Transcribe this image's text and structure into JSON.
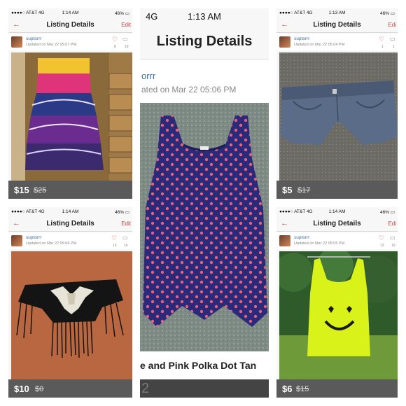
{
  "panels": {
    "p1": {
      "carrier": "●●●●○ AT&T  4G",
      "time": "1:14 AM",
      "battery": "46%",
      "back": "←",
      "title": "Listing Details",
      "edit": "Edit",
      "seller": "suptorrr",
      "updated": "Updated on Mar 22 05:07 PM",
      "likes": "8",
      "comments": "19",
      "price": "$15",
      "original_price": "$25"
    },
    "p2": {
      "carrier": "4G",
      "time": "1:13 AM",
      "title": "Listing Details",
      "seller": "orrr",
      "updated": "ated on Mar 22 05:06 PM",
      "caption": "e and Pink Polka Dot Tan",
      "price_partial": "2"
    },
    "p3": {
      "carrier": "●●●●○ AT&T  4G",
      "time": "1:13 AM",
      "battery": "46%",
      "back": "←",
      "title": "Listing Details",
      "edit": "Edi",
      "seller": "suptorrr",
      "updated": "Updated on Mar 22 05:04 PM",
      "likes": "1",
      "comments": "1",
      "price": "$5",
      "original_price": "$17"
    },
    "p4": {
      "carrier": "●●●●○ AT&T  4G",
      "time": "1:14 AM",
      "battery": "46%",
      "back": "←",
      "title": "Listing Details",
      "edit": "Edit",
      "seller": "suptorrr",
      "updated": "Updated on Mar 22 05:06 PM",
      "likes": "13",
      "comments": "16",
      "price": "$10",
      "original_price": "$0"
    },
    "p5": {
      "carrier": "●●●●○ AT&T  4G",
      "time": "1:14 AM",
      "battery": "46%",
      "back": "←",
      "title": "Listing Details",
      "edit": "Edi",
      "seller": "suptorrr",
      "updated": "Updated on Mar 22 05:05 PM",
      "likes": "13",
      "comments": "19",
      "price": "$6",
      "original_price": "$15"
    }
  }
}
